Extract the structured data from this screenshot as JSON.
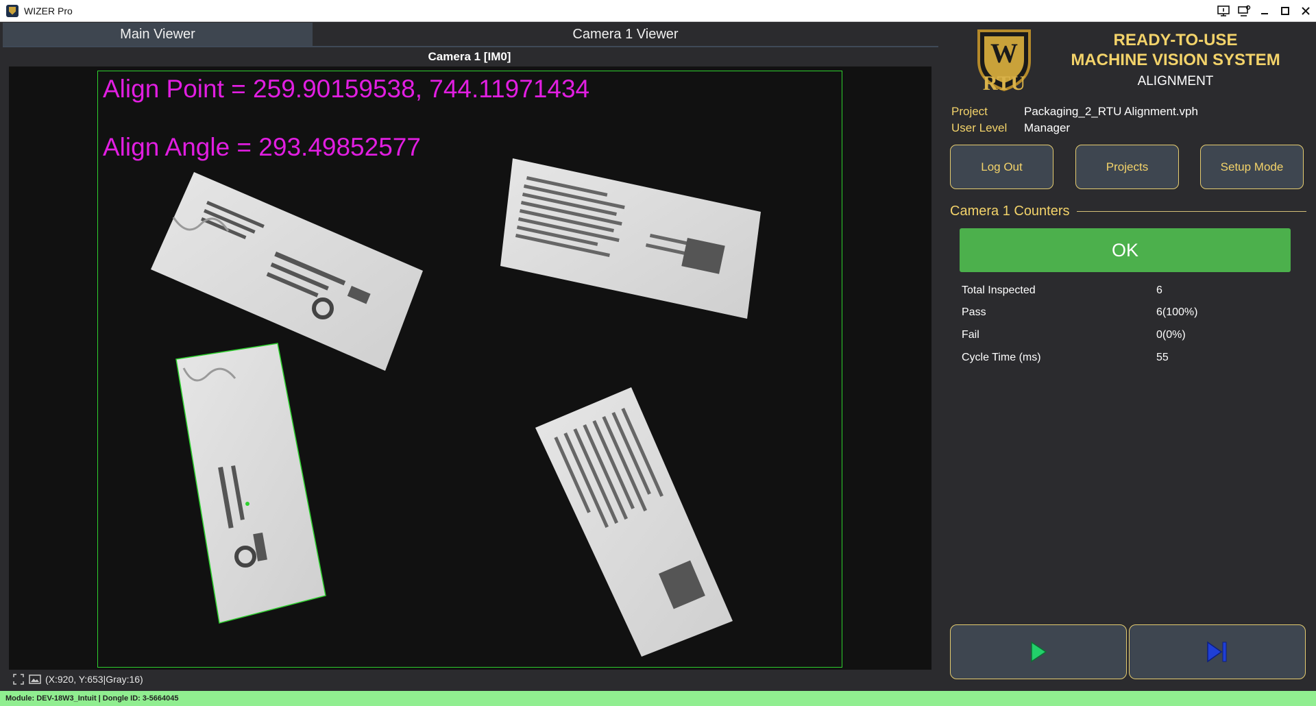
{
  "window": {
    "title": "WIZER Pro"
  },
  "tabs": [
    {
      "label": "Main Viewer",
      "active": true
    },
    {
      "label": "Camera 1 Viewer",
      "active": false
    }
  ],
  "viewer": {
    "title": "Camera 1  [IM0]",
    "overlay": {
      "align_point": "Align Point = 259.90159538, 744.11971434",
      "align_angle": "Align Angle = 293.49852577",
      "text_color": "#e11ee1",
      "roi_color": "#2ed12e"
    },
    "pixel_info": "(X:920, Y:653|Gray:16)",
    "status_icons": [
      "fit-screen-icon",
      "image-icon"
    ]
  },
  "brand": {
    "logo_text": "RTU",
    "line1": "READY-TO-USE",
    "line2": "MACHINE VISION SYSTEM",
    "line3": "ALIGNMENT",
    "accent": "#f3d36a"
  },
  "project": {
    "project_label": "Project",
    "project_value": "Packaging_2_RTU Alignment.vph",
    "user_level_label": "User Level",
    "user_level_value": "Manager"
  },
  "buttons": {
    "logout": "Log Out",
    "projects": "Projects",
    "setup": "Setup Mode"
  },
  "counters": {
    "heading": "Camera 1 Counters",
    "result": "OK",
    "result_color": "#4cb04c",
    "rows": [
      {
        "label": "Total Inspected",
        "value": "6"
      },
      {
        "label": "Pass",
        "value": "6(100%)"
      },
      {
        "label": "Fail",
        "value": "0(0%)"
      },
      {
        "label": "Cycle Time (ms)",
        "value": "55"
      }
    ]
  },
  "controls": {
    "run_icon": "play-icon",
    "run_color": "#22d06a",
    "step_icon": "step-forward-icon",
    "step_color": "#1f3fd6"
  },
  "footer": {
    "text": "Module: DEV-18W3_Intuit | Dongle ID: 3-5664045",
    "color": "#90ee90"
  }
}
